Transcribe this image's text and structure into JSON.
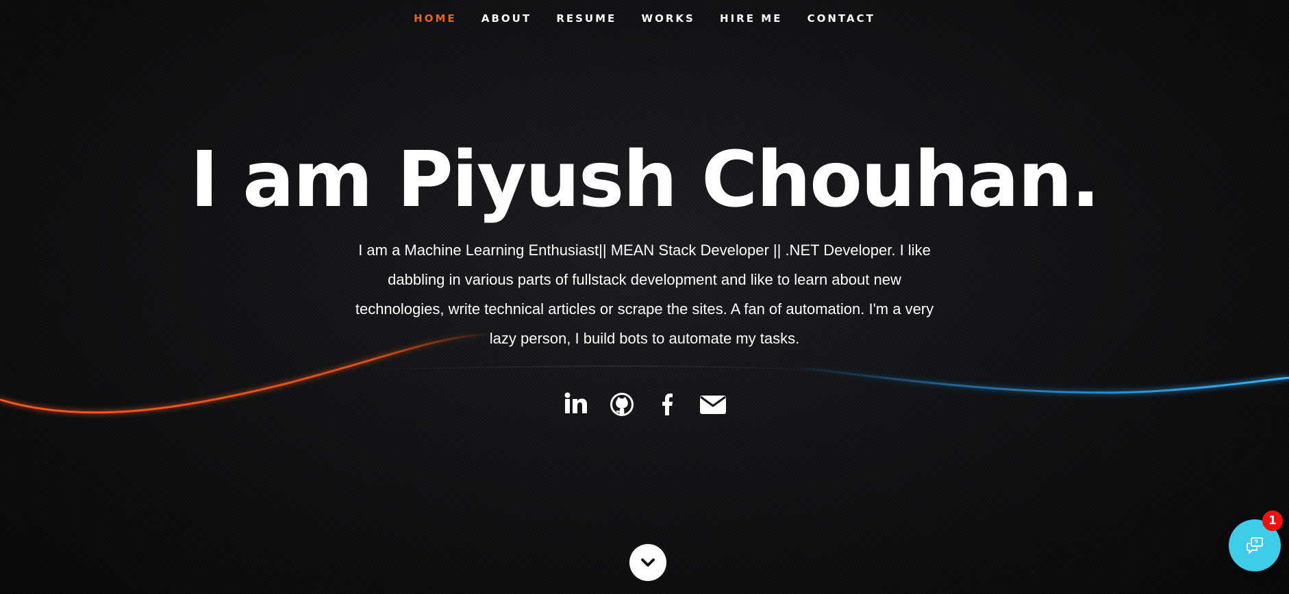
{
  "nav": {
    "items": [
      {
        "label": "HOME",
        "active": true
      },
      {
        "label": "ABOUT",
        "active": false
      },
      {
        "label": "RESUME",
        "active": false
      },
      {
        "label": "WORKS",
        "active": false
      },
      {
        "label": "HIRE ME",
        "active": false
      },
      {
        "label": "CONTACT",
        "active": false
      }
    ]
  },
  "hero": {
    "headline": "I am Piyush Chouhan.",
    "intro": "I am a Machine Learning Enthusiast|| MEAN Stack Developer || .NET Developer. I like dabbling in various parts of fullstack development and like to learn about new technologies, write technical articles or scrape the sites. A fan of automation. I'm a very lazy person, I build bots to automate my tasks."
  },
  "social": [
    {
      "icon": "linkedin-icon"
    },
    {
      "icon": "github-icon"
    },
    {
      "icon": "facebook-icon"
    },
    {
      "icon": "email-icon"
    }
  ],
  "scroll_button": {
    "icon": "chevron-down-icon"
  },
  "chat_widget": {
    "icon": "chat-help-icon",
    "badge_count": "1"
  },
  "colors": {
    "accent": "#e8651f",
    "wave_left": "#ff5a1a",
    "wave_right": "#2aa8ff",
    "chat": "#3ecde8",
    "badge": "#ee1111"
  }
}
